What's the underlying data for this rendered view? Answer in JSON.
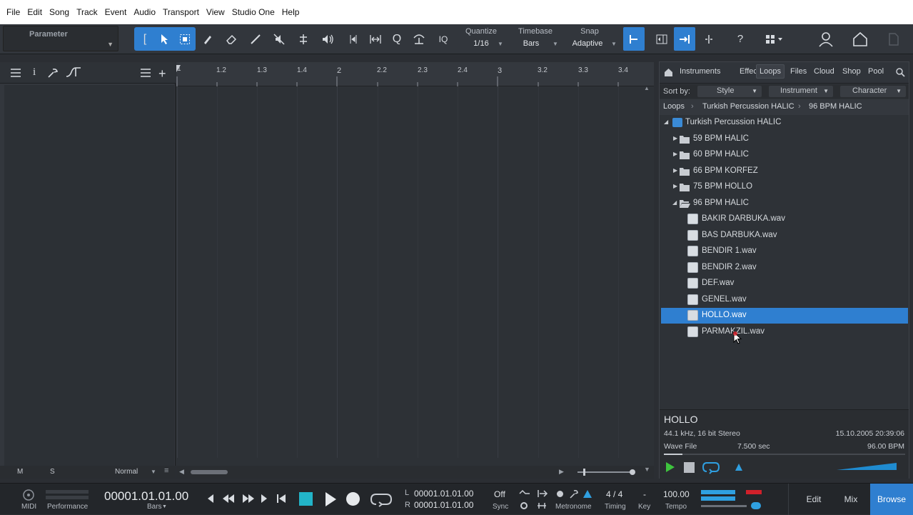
{
  "menu": [
    "File",
    "Edit",
    "Song",
    "Track",
    "Event",
    "Audio",
    "Transport",
    "View",
    "Studio One",
    "Help"
  ],
  "toolbar": {
    "parameter_label": "Parameter",
    "quantize_label": "Quantize",
    "quantize_value": "1/16",
    "timebase_label": "Timebase",
    "timebase_value": "Bars",
    "snap_label": "Snap",
    "snap_value": "Adaptive",
    "iq_label": "IQ",
    "q_label": "Q",
    "help_label": "?"
  },
  "ruler": {
    "labels": [
      "1",
      "1.2",
      "1.3",
      "1.4",
      "2",
      "2.2",
      "2.3",
      "2.4",
      "3",
      "3.2",
      "3.3",
      "3.4"
    ]
  },
  "inspector_footer": {
    "m": "M",
    "s": "S",
    "mode": "Normal"
  },
  "browser": {
    "tabs": [
      "Instruments",
      "Effects",
      "Loops",
      "Files",
      "Cloud",
      "Shop",
      "Pool"
    ],
    "active_tab": "Loops",
    "sort_by_label": "Sort by:",
    "sort_options": [
      "Style",
      "Instrument",
      "Character"
    ],
    "breadcrumb": [
      "Loops",
      "Turkish Percussion HALIC",
      "96 BPM HALIC"
    ],
    "root": "Turkish Percussion HALIC",
    "folders": [
      "59 BPM HALIC",
      "60 BPM HALIC",
      "66 BPM KORFEZ",
      "75 BPM HOLLO",
      "96 BPM HALIC"
    ],
    "files": [
      "BAKIR DARBUKA.wav",
      "BAS DARBUKA.wav",
      "BENDIR 1.wav",
      "BENDIR 2.wav",
      "DEF.wav",
      "GENEL.wav",
      "HOLLO.wav",
      "PARMAKZIL.wav"
    ],
    "selected_file": "HOLLO.wav",
    "info": {
      "name": "HOLLO",
      "format": "44.1 kHz, 16 bit Stereo",
      "date": "15.10.2005 20:39:06",
      "type": "Wave File",
      "length": "7.500 sec",
      "bpm": "96.00 BPM"
    }
  },
  "transport": {
    "midi_label": "MIDI",
    "performance_label": "Performance",
    "position": "00001.01.01.00",
    "position_unit": "Bars",
    "loop_left_label": "L",
    "loop_left": "00001.01.01.00",
    "loop_right_label": "R",
    "loop_right": "00001.01.01.00",
    "sync_value": "Off",
    "sync_label": "Sync",
    "metronome_label": "Metronome",
    "timing_value": "4 / 4",
    "timing_label": "Timing",
    "key_value": "-",
    "key_label": "Key",
    "tempo_value": "100.00",
    "tempo_label": "Tempo",
    "views": [
      "Edit",
      "Mix",
      "Browse"
    ],
    "active_view": "Browse"
  },
  "colors": {
    "accent": "#2f7fd0",
    "play_green": "#3ec43e",
    "record_red": "#d0202a"
  }
}
